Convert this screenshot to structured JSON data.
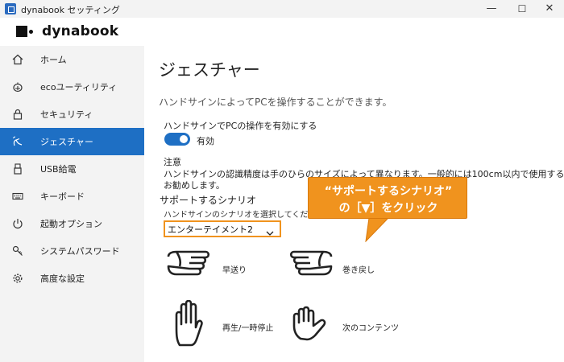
{
  "window": {
    "title": "dynabook セッティング",
    "controls": [
      "minimize-icon",
      "maximize-icon",
      "close-icon"
    ],
    "minimize_glyph": "—",
    "maximize_glyph": "☐",
    "close_glyph": "✕"
  },
  "brand": {
    "name": "dynabook"
  },
  "sidebar": {
    "items": [
      {
        "label": "ホーム",
        "icon": "home-icon",
        "active": false
      },
      {
        "label": "ecoユーティリティ",
        "icon": "eco-icon",
        "active": false
      },
      {
        "label": "セキュリティ",
        "icon": "lock-icon",
        "active": false
      },
      {
        "label": "ジェスチャー",
        "icon": "gesture-icon",
        "active": true
      },
      {
        "label": "USB給電",
        "icon": "usb-icon",
        "active": false
      },
      {
        "label": "キーボード",
        "icon": "keyboard-icon",
        "active": false
      },
      {
        "label": "起動オプション",
        "icon": "power-icon",
        "active": false
      },
      {
        "label": "システムパスワード",
        "icon": "key-icon",
        "active": false
      },
      {
        "label": "高度な設定",
        "icon": "gear-icon",
        "active": false
      }
    ]
  },
  "main": {
    "title": "ジェスチャー",
    "description": "ハンドサインによってPCを操作することができます。",
    "toggle": {
      "label": "ハンドサインでPCの操作を有効にする",
      "state_text": "有効",
      "on": true
    },
    "note": {
      "heading": "注意",
      "line1": "ハンドサインの認識精度は手のひらのサイズによって異なります。一般的には100cm以内で使用することを",
      "line2": "お勧めします。"
    },
    "scenario": {
      "heading": "サポートするシナリオ",
      "description": "ハンドサインのシナリオを選択してください。",
      "selected": "エンターテイメント2"
    },
    "gestures": [
      {
        "label": "早送り",
        "icon": "hand-point-right-icon"
      },
      {
        "label": "巻き戻し",
        "icon": "hand-point-left-icon"
      },
      {
        "label": "再生/一時停止",
        "icon": "open-palm-icon"
      },
      {
        "label": "次のコンテンツ",
        "icon": "hand-thumb-icon"
      }
    ]
  },
  "callout": {
    "line1": "“サポートするシナリオ”",
    "line2": "の［▼］をクリック"
  },
  "colors": {
    "accent": "#1e6fc4",
    "sidebar_bg": "#f3f3f3",
    "callout": "#f0931e"
  }
}
